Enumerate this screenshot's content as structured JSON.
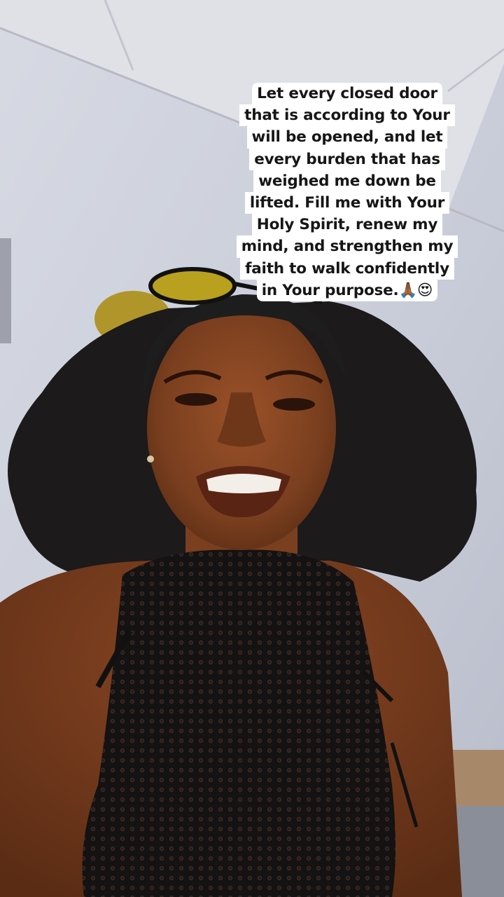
{
  "caption": {
    "lines": [
      "Let every closed door",
      "that is according to Your",
      "will be opened, and let",
      "every burden that has",
      "weighed me down be",
      "lifted. Fill me with Your",
      "Holy Spirit, renew my",
      "mind, and strengthen my",
      "faith to walk confidently",
      "in Your purpose.🙏🏾😍"
    ]
  },
  "colors": {
    "wall": "#c9cdd9",
    "ceiling": "#dfe1e7",
    "skin": "#7a3f1f",
    "hair": "#1c1a1a",
    "top": "#141212",
    "sunglasses_lens": "#b9a11f",
    "caption_bg": "#ffffff",
    "caption_text": "#161616"
  }
}
